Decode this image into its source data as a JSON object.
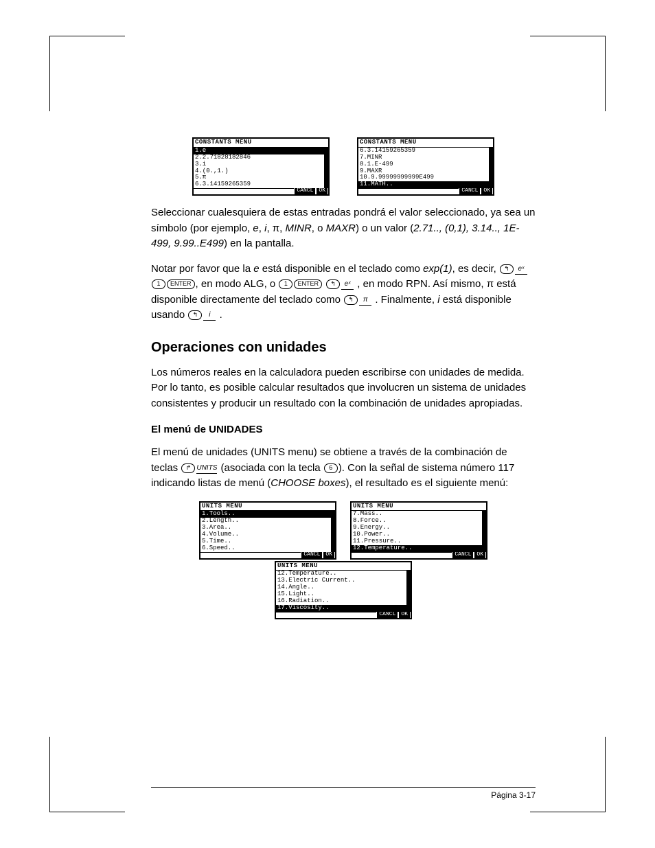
{
  "constants_menu_1": {
    "title": "CONSTANTS MENU",
    "items": [
      {
        "text": "1.e",
        "selected": true
      },
      {
        "text": "2.2.71828182846",
        "selected": false
      },
      {
        "text": "3.i",
        "selected": false
      },
      {
        "text": "4.(0.,1.)",
        "selected": false
      },
      {
        "text": "5.π",
        "selected": false
      },
      {
        "text": "6.3.14159265359",
        "selected": false
      }
    ],
    "soft": {
      "cancel": "CANCL",
      "ok": "OK"
    }
  },
  "constants_menu_2": {
    "title": "CONSTANTS MENU",
    "items": [
      {
        "text": "6.3.14159265359",
        "selected": false
      },
      {
        "text": "7.MINR",
        "selected": false
      },
      {
        "text": "8.1.E-499",
        "selected": false
      },
      {
        "text": "9.MAXR",
        "selected": false
      },
      {
        "text": "10.9.99999999999E499",
        "selected": false
      },
      {
        "text": "11.MATH..",
        "selected": true
      }
    ],
    "soft": {
      "cancel": "CANCL",
      "ok": "OK"
    }
  },
  "para1": {
    "p1a": "Seleccionar cualesquiera de estas entradas pondrá el valor seleccionado, ya sea un símbolo (por ejemplo, ",
    "sym_e": "e",
    "c1": ", ",
    "sym_i": "i",
    "c2": ", π, ",
    "sym_minr": "MINR",
    "c3": ", o ",
    "sym_maxr": "MAXR",
    "p1b": ") o un valor (",
    "vals": "2.71.., (0,1), 3.14.., 1E-499, 9.99..E499",
    "p1c": ") en la pantalla."
  },
  "para2": {
    "a": "Notar por favor que la ",
    "e": "e",
    "b": " está disponible en el teclado como ",
    "exp1": "exp(1)",
    "c": ", es decir, ",
    "alg": ", en modo ALG, o ",
    "rpn": ", en modo RPN.  Así mismo, π está disponible directamente del teclado como ",
    "fin1": ". Finalmente, ",
    "i": "i",
    "fin2": " está disponible usando ",
    "dot": "."
  },
  "keys": {
    "left_shift_icon": "↰",
    "right_shift_icon": "↱",
    "ex": "eˣ",
    "one": "1",
    "enter": "ENTER",
    "pi": "π",
    "i": "i",
    "units": "UNITS",
    "six": "6"
  },
  "heading2": "Operaciones con unidades",
  "para3": "Los números reales en la calculadora pueden escribirse con unidades de medida.  Por lo tanto, es posible calcular resultados que involucren un sistema de unidades consistentes y producir un resultado con la combinación de unidades apropiadas.",
  "heading3": "El menú de UNIDADES",
  "para4": {
    "a": "El menú de unidades  (UNITS menu) se obtiene a través de la combinación de teclas ",
    "b": "(asociada con la tecla ",
    "c": ").  Con la señal de sistema número 117 indicando listas de menú (",
    "choose": "CHOOSE boxes",
    "d": "), el resultado es el siguiente menú:"
  },
  "units_menu_1": {
    "title": "UNITS MENU",
    "items": [
      {
        "text": "1.Tools..",
        "selected": true
      },
      {
        "text": "2.Length..",
        "selected": false
      },
      {
        "text": "3.Area..",
        "selected": false
      },
      {
        "text": "4.Volume..",
        "selected": false
      },
      {
        "text": "5.Time..",
        "selected": false
      },
      {
        "text": "6.Speed..",
        "selected": false
      }
    ],
    "soft": {
      "cancel": "CANCL",
      "ok": "OK"
    }
  },
  "units_menu_2": {
    "title": "UNITS MENU",
    "items": [
      {
        "text": "7.Mass..",
        "selected": false
      },
      {
        "text": "8.Force..",
        "selected": false
      },
      {
        "text": "9.Energy..",
        "selected": false
      },
      {
        "text": "10.Power..",
        "selected": false
      },
      {
        "text": "11.Pressure..",
        "selected": false
      },
      {
        "text": "12.Temperature..",
        "selected": true
      }
    ],
    "soft": {
      "cancel": "CANCL",
      "ok": "OK"
    }
  },
  "units_menu_3": {
    "title": "UNITS MENU",
    "items": [
      {
        "text": "12.Temperature..",
        "selected": false
      },
      {
        "text": "13.Electric Current..",
        "selected": false
      },
      {
        "text": "14.Angle..",
        "selected": false
      },
      {
        "text": "15.Light..",
        "selected": false
      },
      {
        "text": "16.Radiation..",
        "selected": false
      },
      {
        "text": "17.Viscosity..",
        "selected": true
      }
    ],
    "soft": {
      "cancel": "CANCL",
      "ok": "OK"
    }
  },
  "footer": "Página 3-17"
}
